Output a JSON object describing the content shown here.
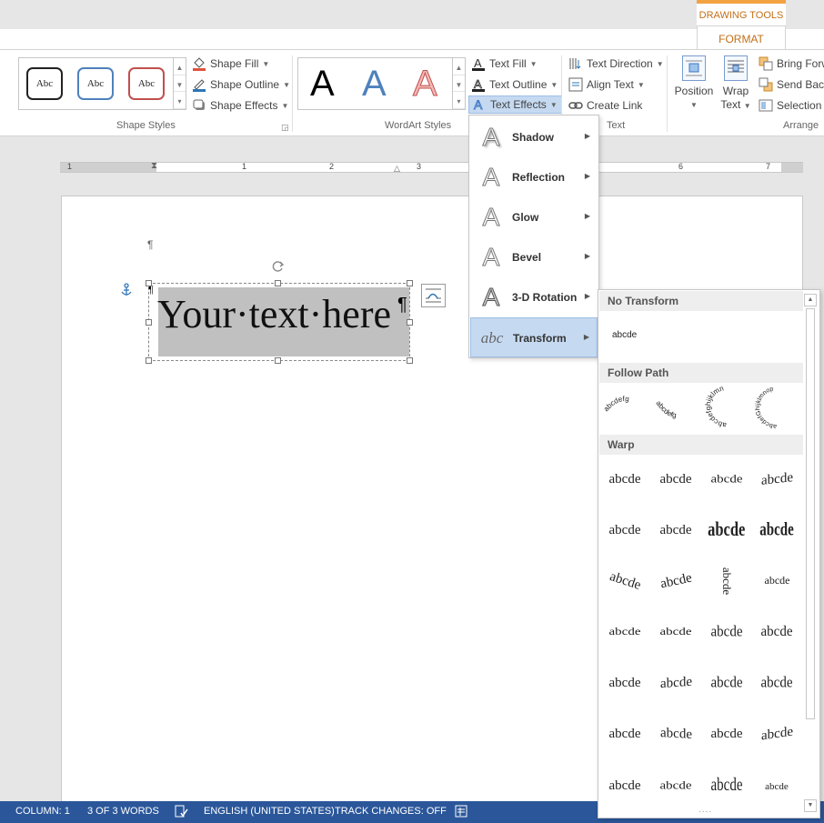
{
  "ribbon": {
    "contextual_title": "DRAWING TOOLS",
    "active_tab": "FORMAT",
    "shape_styles": {
      "label": "Shape Styles",
      "swatches": [
        {
          "text": "Abc",
          "border": "#222222"
        },
        {
          "text": "Abc",
          "border": "#4f81bd"
        },
        {
          "text": "Abc",
          "border": "#c0504d"
        }
      ],
      "shape_fill": "Shape Fill",
      "shape_outline": "Shape Outline",
      "shape_effects": "Shape Effects"
    },
    "wordart_styles": {
      "label": "WordArt Styles",
      "letters": [
        {
          "text": "A",
          "color": "#000000"
        },
        {
          "text": "A",
          "color": "#4f81bd"
        },
        {
          "text": "A",
          "color": "#f2b8b6"
        }
      ],
      "text_fill": "Text Fill",
      "text_outline": "Text Outline",
      "text_effects": "Text Effects"
    },
    "text_group": {
      "label": "Text",
      "text_direction": "Text Direction",
      "align_text": "Align Text",
      "create_link": "Create Link"
    },
    "arrange": {
      "label": "Arrange",
      "position": "Position",
      "wrap_line1": "Wrap",
      "wrap_line2": "Text",
      "bring_forward": "Bring Forw",
      "send_backward": "Send Back",
      "selection_pane": "Selection P"
    }
  },
  "ruler": {
    "numbers": [
      "1",
      "1",
      "2",
      "3",
      "6",
      "7"
    ]
  },
  "document": {
    "pilcrow": "¶",
    "textbox_text": "Your·text·here"
  },
  "effects_menu": {
    "items": [
      {
        "label": "Shadow",
        "icon": "A",
        "active": false
      },
      {
        "label": "Reflection",
        "icon": "A",
        "active": false
      },
      {
        "label": "Glow",
        "icon": "A",
        "active": false
      },
      {
        "label": "Bevel",
        "icon": "A",
        "active": false
      },
      {
        "label": "3-D Rotation",
        "icon": "A",
        "active": false
      },
      {
        "label": "Transform",
        "icon": "abc",
        "active": true
      }
    ]
  },
  "transform_panel": {
    "no_transform_heading": "No Transform",
    "no_transform_sample": "abcde",
    "follow_path_heading": "Follow Path",
    "follow_path_samples": [
      "abcdefg",
      "abcdefg",
      "abcdefghijklmn",
      "abcdefGhijklmnop"
    ],
    "warp_heading": "Warp",
    "warp_sample": "abcde"
  },
  "statusbar": {
    "column": "COLUMN: 1",
    "words": "3 OF 3 WORDS",
    "language": "ENGLISH (UNITED STATES)",
    "track_changes": "TRACK CHANGES: OFF"
  },
  "colors": {
    "accent_orange": "#c36f17",
    "status_blue": "#2b579a",
    "menu_highlight": "#c5d9f1"
  }
}
